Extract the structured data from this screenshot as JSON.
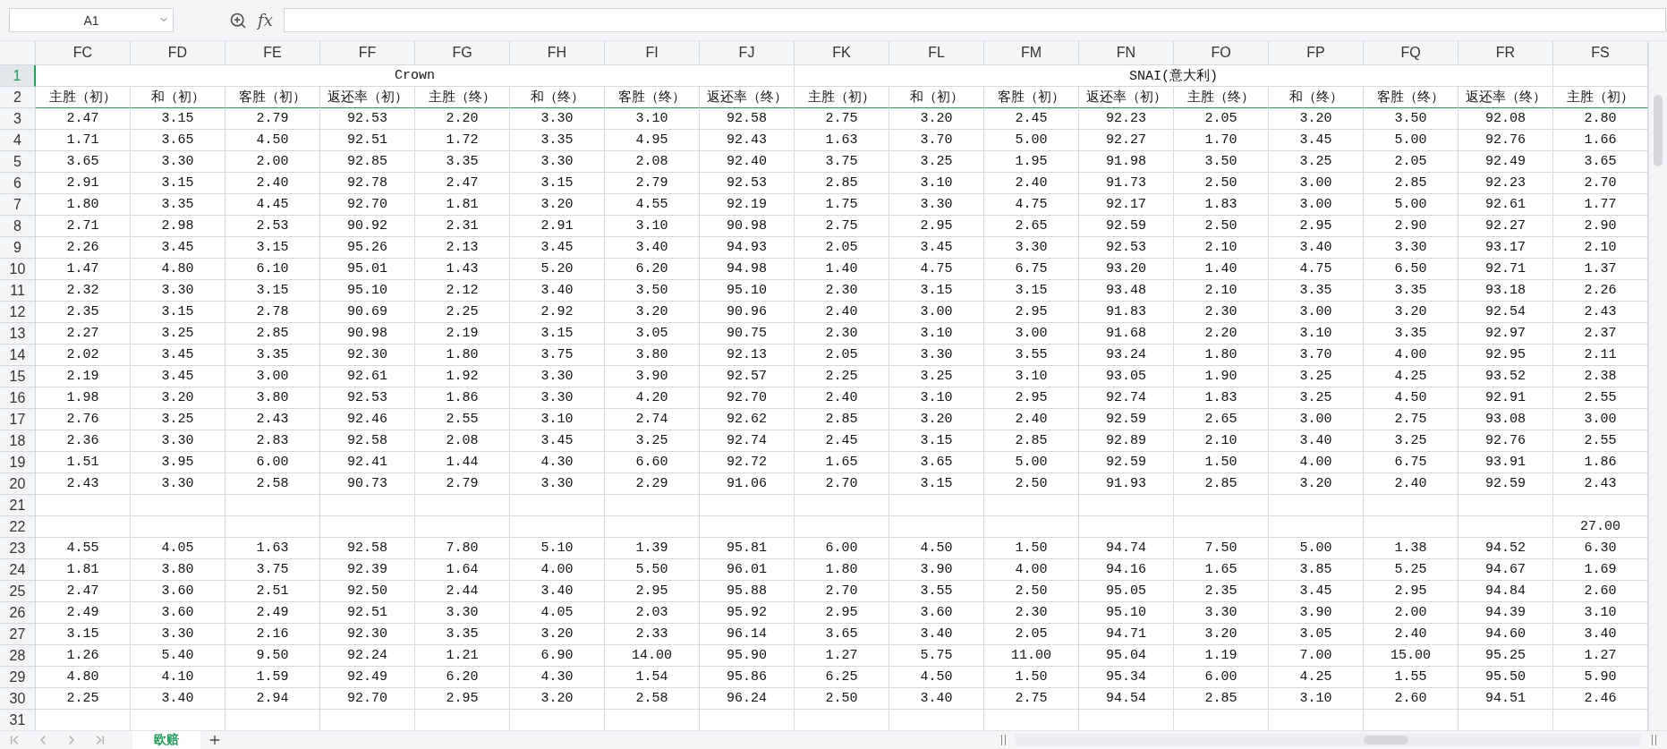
{
  "name_box": {
    "value": "A1"
  },
  "formula_bar": {
    "function_label": "fx"
  },
  "columns": [
    "FC",
    "FD",
    "FE",
    "FF",
    "FG",
    "FH",
    "FI",
    "FJ",
    "FK",
    "FL",
    "FM",
    "FN",
    "FO",
    "FP",
    "FQ",
    "FR",
    "FS"
  ],
  "header_rows": [
    {
      "number": "1",
      "selected": true
    },
    {
      "number": "2",
      "selected": false
    }
  ],
  "groups": [
    {
      "label": "Crown",
      "subheaders": [
        "主胜（初）",
        "和（初）",
        "客胜（初）",
        "返还率（初）",
        "主胜（终）",
        "和（终）",
        "客胜（终）",
        "返还率（终）"
      ]
    },
    {
      "label": "SNAI(意大利)",
      "subheaders": [
        "主胜（初）",
        "和（初）",
        "客胜（初）",
        "返还率（初）",
        "主胜（终）",
        "和（终）",
        "客胜（终）",
        "返还率（终）"
      ]
    },
    {
      "subheaders": [
        "主胜（初）"
      ]
    }
  ],
  "rows": [
    {
      "number": "3",
      "selected": false,
      "cells": [
        "2.47",
        "3.15",
        "2.79",
        "92.53",
        "2.20",
        "3.30",
        "3.10",
        "92.58",
        "2.75",
        "3.20",
        "2.45",
        "92.23",
        "2.05",
        "3.20",
        "3.50",
        "92.08",
        "2.80"
      ]
    },
    {
      "number": "4",
      "selected": false,
      "cells": [
        "1.71",
        "3.65",
        "4.50",
        "92.51",
        "1.72",
        "3.35",
        "4.95",
        "92.43",
        "1.63",
        "3.70",
        "5.00",
        "92.27",
        "1.70",
        "3.45",
        "5.00",
        "92.76",
        "1.66"
      ]
    },
    {
      "number": "5",
      "selected": false,
      "cells": [
        "3.65",
        "3.30",
        "2.00",
        "92.85",
        "3.35",
        "3.30",
        "2.08",
        "92.40",
        "3.75",
        "3.25",
        "1.95",
        "91.98",
        "3.50",
        "3.25",
        "2.05",
        "92.49",
        "3.65"
      ]
    },
    {
      "number": "6",
      "selected": false,
      "cells": [
        "2.91",
        "3.15",
        "2.40",
        "92.78",
        "2.47",
        "3.15",
        "2.79",
        "92.53",
        "2.85",
        "3.10",
        "2.40",
        "91.73",
        "2.50",
        "3.00",
        "2.85",
        "92.23",
        "2.70"
      ]
    },
    {
      "number": "7",
      "selected": false,
      "cells": [
        "1.80",
        "3.35",
        "4.45",
        "92.70",
        "1.81",
        "3.20",
        "4.55",
        "92.19",
        "1.75",
        "3.30",
        "4.75",
        "92.17",
        "1.83",
        "3.00",
        "5.00",
        "92.61",
        "1.77"
      ]
    },
    {
      "number": "8",
      "selected": false,
      "cells": [
        "2.71",
        "2.98",
        "2.53",
        "90.92",
        "2.31",
        "2.91",
        "3.10",
        "90.98",
        "2.75",
        "2.95",
        "2.65",
        "92.59",
        "2.50",
        "2.95",
        "2.90",
        "92.27",
        "2.90"
      ]
    },
    {
      "number": "9",
      "selected": false,
      "cells": [
        "2.26",
        "3.45",
        "3.15",
        "95.26",
        "2.13",
        "3.45",
        "3.40",
        "94.93",
        "2.05",
        "3.45",
        "3.30",
        "92.53",
        "2.10",
        "3.40",
        "3.30",
        "93.17",
        "2.10"
      ]
    },
    {
      "number": "10",
      "selected": false,
      "cells": [
        "1.47",
        "4.80",
        "6.10",
        "95.01",
        "1.43",
        "5.20",
        "6.20",
        "94.98",
        "1.40",
        "4.75",
        "6.75",
        "93.20",
        "1.40",
        "4.75",
        "6.50",
        "92.71",
        "1.37"
      ]
    },
    {
      "number": "11",
      "selected": false,
      "cells": [
        "2.32",
        "3.30",
        "3.15",
        "95.10",
        "2.12",
        "3.40",
        "3.50",
        "95.10",
        "2.30",
        "3.15",
        "3.15",
        "93.48",
        "2.10",
        "3.35",
        "3.35",
        "93.18",
        "2.26"
      ]
    },
    {
      "number": "12",
      "selected": false,
      "cells": [
        "2.35",
        "3.15",
        "2.78",
        "90.69",
        "2.25",
        "2.92",
        "3.20",
        "90.96",
        "2.40",
        "3.00",
        "2.95",
        "91.83",
        "2.30",
        "3.00",
        "3.20",
        "92.54",
        "2.43"
      ]
    },
    {
      "number": "13",
      "selected": false,
      "cells": [
        "2.27",
        "3.25",
        "2.85",
        "90.98",
        "2.19",
        "3.15",
        "3.05",
        "90.75",
        "2.30",
        "3.10",
        "3.00",
        "91.68",
        "2.20",
        "3.10",
        "3.35",
        "92.97",
        "2.37"
      ]
    },
    {
      "number": "14",
      "selected": false,
      "cells": [
        "2.02",
        "3.45",
        "3.35",
        "92.30",
        "1.80",
        "3.75",
        "3.80",
        "92.13",
        "2.05",
        "3.30",
        "3.55",
        "93.24",
        "1.80",
        "3.70",
        "4.00",
        "92.95",
        "2.11"
      ]
    },
    {
      "number": "15",
      "selected": false,
      "cells": [
        "2.19",
        "3.45",
        "3.00",
        "92.61",
        "1.92",
        "3.30",
        "3.90",
        "92.57",
        "2.25",
        "3.25",
        "3.10",
        "93.05",
        "1.90",
        "3.25",
        "4.25",
        "93.52",
        "2.38"
      ]
    },
    {
      "number": "16",
      "selected": false,
      "cells": [
        "1.98",
        "3.20",
        "3.80",
        "92.53",
        "1.86",
        "3.30",
        "4.20",
        "92.70",
        "2.40",
        "3.10",
        "2.95",
        "92.74",
        "1.83",
        "3.25",
        "4.50",
        "92.91",
        "2.55"
      ]
    },
    {
      "number": "17",
      "selected": false,
      "cells": [
        "2.76",
        "3.25",
        "2.43",
        "92.46",
        "2.55",
        "3.10",
        "2.74",
        "92.62",
        "2.85",
        "3.20",
        "2.40",
        "92.59",
        "2.65",
        "3.00",
        "2.75",
        "93.08",
        "3.00"
      ]
    },
    {
      "number": "18",
      "selected": false,
      "cells": [
        "2.36",
        "3.30",
        "2.83",
        "92.58",
        "2.08",
        "3.45",
        "3.25",
        "92.74",
        "2.45",
        "3.15",
        "2.85",
        "92.89",
        "2.10",
        "3.40",
        "3.25",
        "92.76",
        "2.55"
      ]
    },
    {
      "number": "19",
      "selected": false,
      "cells": [
        "1.51",
        "3.95",
        "6.00",
        "92.41",
        "1.44",
        "4.30",
        "6.60",
        "92.72",
        "1.65",
        "3.65",
        "5.00",
        "92.59",
        "1.50",
        "4.00",
        "6.75",
        "93.91",
        "1.86"
      ]
    },
    {
      "number": "20",
      "selected": false,
      "cells": [
        "2.43",
        "3.30",
        "2.58",
        "90.73",
        "2.79",
        "3.30",
        "2.29",
        "91.06",
        "2.70",
        "3.15",
        "2.50",
        "91.93",
        "2.85",
        "3.20",
        "2.40",
        "92.59",
        "2.43"
      ]
    },
    {
      "number": "21",
      "selected": false
    },
    {
      "number": "22",
      "selected": false,
      "cells": [
        null,
        null,
        null,
        null,
        null,
        null,
        null,
        null,
        null,
        null,
        null,
        null,
        null,
        null,
        null,
        null,
        "27.00"
      ]
    },
    {
      "number": "23",
      "selected": false,
      "cells": [
        "4.55",
        "4.05",
        "1.63",
        "92.58",
        "7.80",
        "5.10",
        "1.39",
        "95.81",
        "6.00",
        "4.50",
        "1.50",
        "94.74",
        "7.50",
        "5.00",
        "1.38",
        "94.52",
        "6.30"
      ]
    },
    {
      "number": "24",
      "selected": false,
      "cells": [
        "1.81",
        "3.80",
        "3.75",
        "92.39",
        "1.64",
        "4.00",
        "5.50",
        "96.01",
        "1.80",
        "3.90",
        "4.00",
        "94.16",
        "1.65",
        "3.85",
        "5.25",
        "94.67",
        "1.69"
      ]
    },
    {
      "number": "25",
      "selected": false,
      "cells": [
        "2.47",
        "3.60",
        "2.51",
        "92.50",
        "2.44",
        "3.40",
        "2.95",
        "95.88",
        "2.70",
        "3.55",
        "2.50",
        "95.05",
        "2.35",
        "3.45",
        "2.95",
        "94.84",
        "2.60"
      ]
    },
    {
      "number": "26",
      "selected": false,
      "cells": [
        "2.49",
        "3.60",
        "2.49",
        "92.51",
        "3.30",
        "4.05",
        "2.03",
        "95.92",
        "2.95",
        "3.60",
        "2.30",
        "95.10",
        "3.30",
        "3.90",
        "2.00",
        "94.39",
        "3.10"
      ]
    },
    {
      "number": "27",
      "selected": false,
      "cells": [
        "3.15",
        "3.30",
        "2.16",
        "92.30",
        "3.35",
        "3.20",
        "2.33",
        "96.14",
        "3.65",
        "3.40",
        "2.05",
        "94.71",
        "3.20",
        "3.05",
        "2.40",
        "94.60",
        "3.40"
      ]
    },
    {
      "number": "28",
      "selected": false,
      "cells": [
        "1.26",
        "5.40",
        "9.50",
        "92.24",
        "1.21",
        "6.90",
        "14.00",
        "95.90",
        "1.27",
        "5.75",
        "11.00",
        "95.04",
        "1.19",
        "7.00",
        "15.00",
        "95.25",
        "1.27"
      ]
    },
    {
      "number": "29",
      "selected": false,
      "cells": [
        "4.80",
        "4.10",
        "1.59",
        "92.49",
        "6.20",
        "4.30",
        "1.54",
        "95.86",
        "6.25",
        "4.50",
        "1.50",
        "95.34",
        "6.00",
        "4.25",
        "1.55",
        "95.50",
        "5.90"
      ]
    },
    {
      "number": "30",
      "selected": false,
      "cells": [
        "2.25",
        "3.40",
        "2.94",
        "92.70",
        "2.95",
        "3.20",
        "2.58",
        "96.24",
        "2.50",
        "3.40",
        "2.75",
        "94.54",
        "2.85",
        "3.10",
        "2.60",
        "94.51",
        "2.46"
      ]
    },
    {
      "number": "31",
      "selected": false
    }
  ],
  "sheet_tabs": [
    {
      "label": "欧赔",
      "selected": true
    }
  ]
}
